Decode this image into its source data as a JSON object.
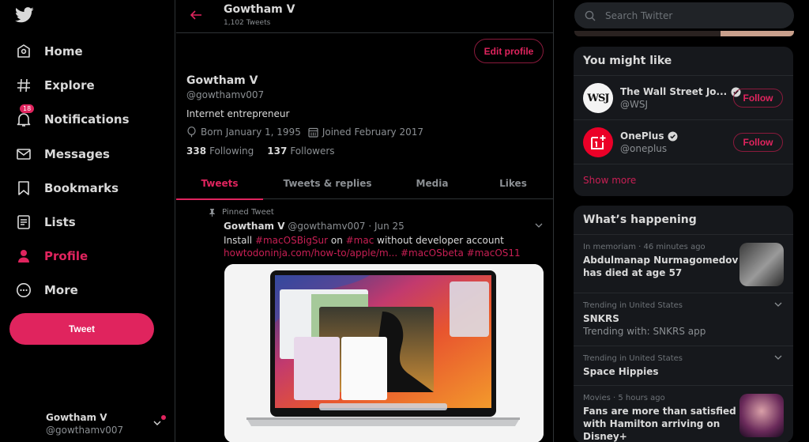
{
  "colors": {
    "accent": "#e0245e",
    "background": "#000000",
    "card": "#16181c",
    "text": "#d9d9d9",
    "muted": "#8b8f93"
  },
  "nav": {
    "logo": "twitter-bird-icon",
    "items": [
      {
        "label": "Home",
        "icon": "home-icon"
      },
      {
        "label": "Explore",
        "icon": "hashtag-icon"
      },
      {
        "label": "Notifications",
        "icon": "bell-icon",
        "badge": "18"
      },
      {
        "label": "Messages",
        "icon": "envelope-icon"
      },
      {
        "label": "Bookmarks",
        "icon": "bookmark-icon"
      },
      {
        "label": "Lists",
        "icon": "list-icon"
      },
      {
        "label": "Profile",
        "icon": "person-icon",
        "active": true
      },
      {
        "label": "More",
        "icon": "more-circle-icon"
      }
    ],
    "tweet_button": "Tweet",
    "account": {
      "name": "Gowtham V",
      "handle": "@gowthamv007"
    }
  },
  "header": {
    "title": "Gowtham V",
    "subtitle": "1,102 Tweets"
  },
  "profile": {
    "edit_button": "Edit profile",
    "name": "Gowtham V",
    "handle": "@gowthamv007",
    "bio": "Internet entrepreneur",
    "born": "Born January 1, 1995",
    "joined": "Joined February 2017",
    "following_count": "338",
    "following_label": "Following",
    "followers_count": "137",
    "followers_label": "Followers"
  },
  "tabs": [
    {
      "label": "Tweets",
      "active": true
    },
    {
      "label": "Tweets & replies"
    },
    {
      "label": "Media"
    },
    {
      "label": "Likes"
    }
  ],
  "pinned_tweet": {
    "pinned_label": "Pinned Tweet",
    "author": "Gowtham V",
    "handle": "@gowthamv007",
    "separator": "·",
    "date": "Jun 25",
    "text_parts": {
      "t1": "Install ",
      "h1": "#macOSBigSur",
      "t2": " on ",
      "h2": "#mac",
      "t3": " without developer account",
      "link": "howtodoninja.com/how-to/apple/m...",
      "h3": "#macOSbeta",
      "h4": "#macOS11"
    },
    "media_alt": "MacBook Pro showing macOS Big Sur desktop"
  },
  "search": {
    "placeholder": "Search Twitter"
  },
  "who_to_follow": {
    "title": "You might like",
    "accounts": [
      {
        "name": "The Wall Street Jo...",
        "handle": "@WSJ",
        "avatar_text": "WSJ",
        "verified": true,
        "button": "Follow"
      },
      {
        "name": "OnePlus",
        "handle": "@oneplus",
        "avatar_text": "1+",
        "verified": true,
        "button": "Follow"
      }
    ],
    "show_more": "Show more"
  },
  "trends": {
    "title": "What’s happening",
    "items": [
      {
        "context": "In memoriam · 46 minutes ago",
        "title": "Abdulmanap Nurmagomedov has died at age 57",
        "has_image": true
      },
      {
        "context": "Trending in United States",
        "title": "SNKRS",
        "subtitle": "Trending with: SNKRS app",
        "has_menu": true
      },
      {
        "context": "Trending in United States",
        "title": "Space Hippies",
        "has_menu": true
      },
      {
        "context": "Movies · 5 hours ago",
        "title": "Fans are more than satisfied with Hamilton arriving on Disney+",
        "has_image": true
      }
    ]
  }
}
